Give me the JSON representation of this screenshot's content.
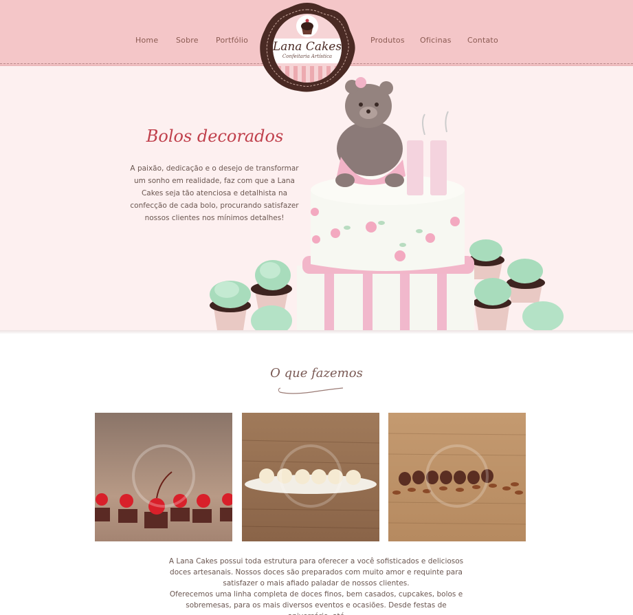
{
  "nav": {
    "items": [
      {
        "label": "Home"
      },
      {
        "label": "Sobre"
      },
      {
        "label": "Portfólio"
      },
      {
        "label": "Produtos"
      },
      {
        "label": "Oficinas"
      },
      {
        "label": "Contato"
      }
    ]
  },
  "logo": {
    "name": "Lana Cakes",
    "tagline": "Confeitaria Artística",
    "icon": "cupcake-icon"
  },
  "hero": {
    "title": "Bolos decorados",
    "text": "A paixão, dedicação e o desejo de transformar um sonho em realidade, faz com que a Lana Cakes seja tão atenciosa e detalhista na confecção de cada bolo, procurando satisfazer nossos clientes nos mínimos detalhes!",
    "candle_number": "11"
  },
  "section": {
    "title": "O que fazemos",
    "paragraph1": "A Lana Cakes possui toda estrutura para oferecer a você sofisticados e deliciosos doces artesanais. Nossos doces são preparados com muito amor e requinte para satisfazer o mais afiado paladar de nossos clientes.",
    "paragraph2": "Oferecemos uma linha completa de doces finos, bem casados, cupcakes, bolos e sobremesas, para os mais diversos eventos e ocasiões. Desde festas de aniversário, até"
  },
  "colors": {
    "header": "#f4c6c8",
    "hero_bg": "#fdf0f0",
    "title_red": "#c0404c",
    "logo_brown": "#4a2a24"
  }
}
